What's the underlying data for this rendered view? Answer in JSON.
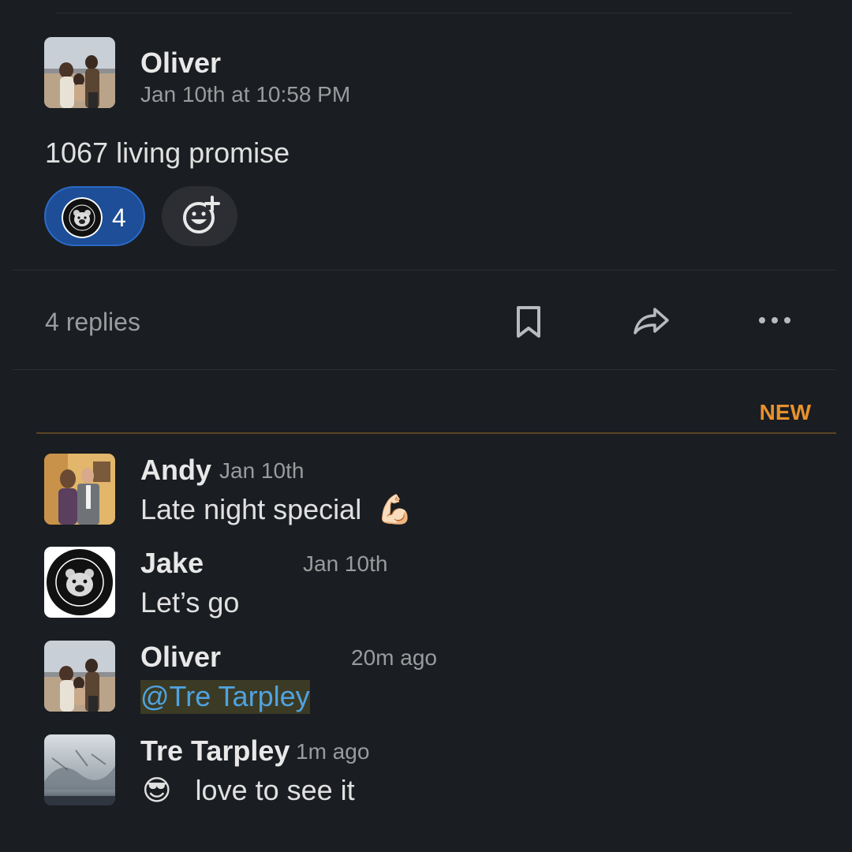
{
  "parent": {
    "author": "Oliver",
    "timestamp": "Jan 10th at 10:58 PM",
    "text": "1067 living promise",
    "reaction": {
      "count": "4",
      "emoji": "family-first-life-bear"
    }
  },
  "thread_bar": {
    "replies_label": "4 replies",
    "actions": [
      "bookmark-icon",
      "share-icon",
      "more-icon"
    ]
  },
  "new_divider": {
    "label": "NEW",
    "color": "#e8912d"
  },
  "replies": [
    {
      "author": "Andy",
      "timestamp": "Jan 10th",
      "text": "Late night special",
      "emoji": "💪🏻"
    },
    {
      "author": "Jake",
      "timestamp": "Jan 10th",
      "text": "Let’s go"
    },
    {
      "author": "Oliver",
      "timestamp": "20m ago",
      "mention": "@Tre Tarpley"
    },
    {
      "author": "Tre Tarpley",
      "timestamp": "1m ago",
      "emoji": "😎",
      "text": "love to see it"
    }
  ],
  "colors": {
    "background": "#1a1d21",
    "mention_link": "#4fa3e0",
    "reaction_active": "#1d4e97"
  }
}
